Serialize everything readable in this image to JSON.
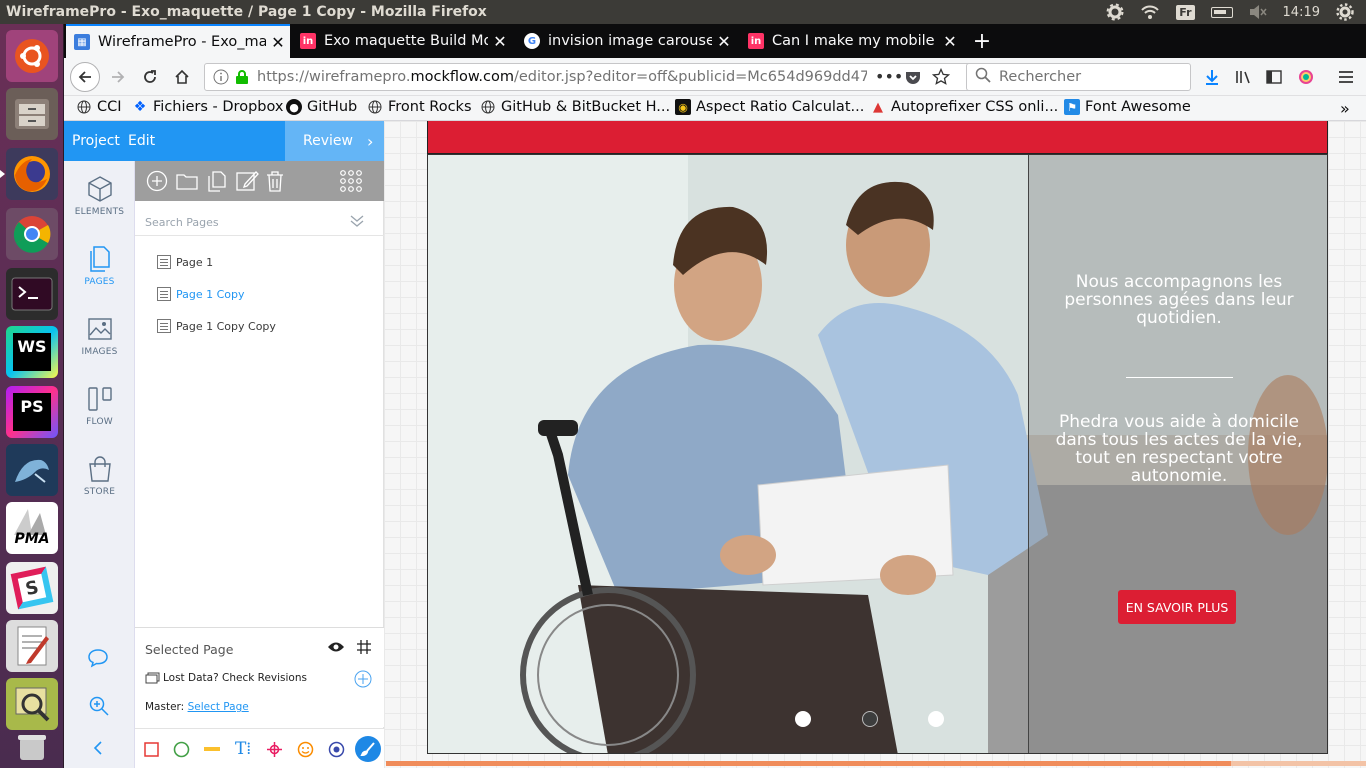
{
  "system": {
    "window_title": "WireframePro - Exo_maquette / Page 1 Copy - Mozilla Firefox",
    "keyboard_layout": "Fr",
    "clock": "14:19"
  },
  "launcher": {
    "items": [
      {
        "name": "ubuntu-dash-icon",
        "label": ""
      },
      {
        "name": "files-icon",
        "label": ""
      },
      {
        "name": "firefox-icon",
        "label": ""
      },
      {
        "name": "chrome-icon",
        "label": ""
      },
      {
        "name": "terminal-icon",
        "label": ""
      },
      {
        "name": "webstorm-icon",
        "label": "WS"
      },
      {
        "name": "phpstorm-icon",
        "label": "PS"
      },
      {
        "name": "mysql-workbench-icon",
        "label": ""
      },
      {
        "name": "phpmyadmin-icon",
        "label": "PMA"
      },
      {
        "name": "slack-icon",
        "label": "S"
      },
      {
        "name": "text-editor-icon",
        "label": ""
      },
      {
        "name": "image-viewer-icon",
        "label": ""
      },
      {
        "name": "trash-icon",
        "label": ""
      }
    ]
  },
  "browser": {
    "tabs": [
      {
        "label": "WireframePro - Exo_maquette",
        "active": true
      },
      {
        "label": "Exo maquette Build Mode",
        "active": false
      },
      {
        "label": "invision image carousel",
        "active": false
      },
      {
        "label": "Can I make my mobile prototype",
        "active": false
      }
    ],
    "url": {
      "prefix": "https://wireframepro.",
      "domain": "mockflow.com",
      "path": "/editor.jsp?editor=off&publicid=Mc654d969dd47"
    },
    "search_placeholder": "Rechercher",
    "bookmarks": [
      "CCI",
      "Fichiers - Dropbox",
      "GitHub",
      "Front Rocks",
      "GitHub & BitBucket H...",
      "Aspect Ratio Calculat...",
      "Autoprefixer CSS onli...",
      "Font Awesome"
    ]
  },
  "editor": {
    "menu": {
      "project": "Project",
      "edit": "Edit",
      "review": "Review"
    },
    "rail": [
      {
        "label": "ELEMENTS"
      },
      {
        "label": "PAGES"
      },
      {
        "label": "IMAGES"
      },
      {
        "label": "FLOW"
      },
      {
        "label": "STORE"
      }
    ],
    "search_pages_placeholder": "Search Pages",
    "pages": [
      {
        "label": "Page 1",
        "active": false
      },
      {
        "label": "Page 1 Copy",
        "active": true
      },
      {
        "label": "Page 1 Copy Copy",
        "active": false
      }
    ],
    "selected_page": {
      "title": "Selected Page",
      "revisions": "Lost Data? Check Revisions",
      "master_label": "Master:",
      "master_link": "Select Page"
    }
  },
  "mockup": {
    "hero_text_1": "Nous accompagnons les personnes  agées dans leur quotidien.",
    "hero_text_2": "Phedra vous aide à domicile dans tous les actes de la vie, tout en respectant votre autonomie.",
    "cta_label": "EN SAVOIR PLUS",
    "carousel": {
      "slides": 3,
      "current": 2
    },
    "colors": {
      "brand_red": "#dc1e33",
      "accent_blue": "#2196f3"
    }
  }
}
